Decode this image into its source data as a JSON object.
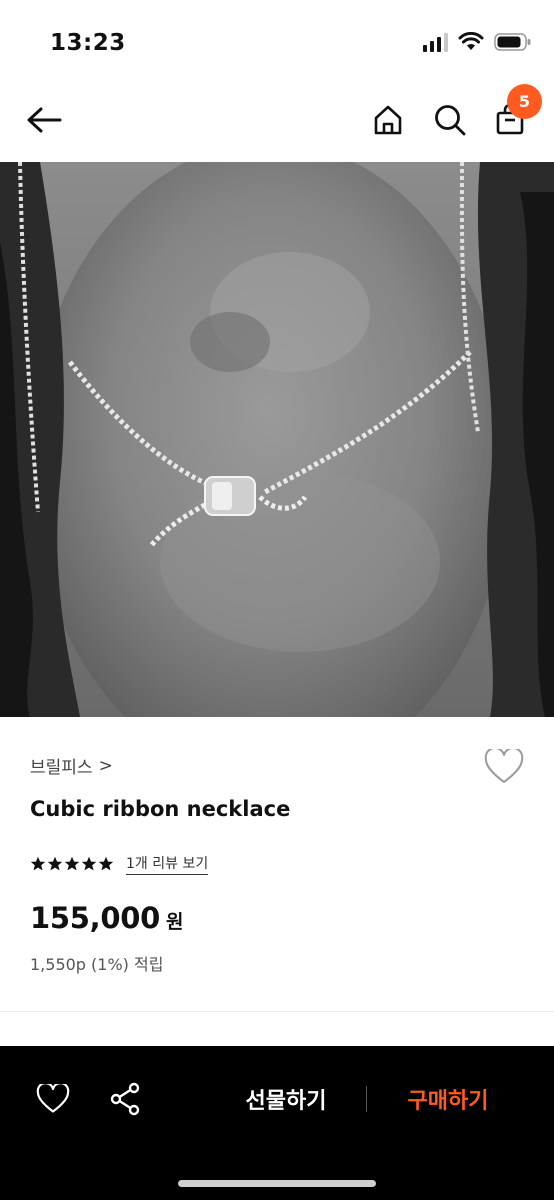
{
  "status_bar": {
    "time": "13:23"
  },
  "nav": {
    "cart_count": "5",
    "icons": [
      "back-arrow-icon",
      "home-icon",
      "search-icon",
      "shopping-bag-icon"
    ]
  },
  "product": {
    "brand": "브릴피스",
    "brand_chevron": ">",
    "name": "Cubic ribbon necklace",
    "rating_stars": 5,
    "review_link": "1개 리뷰 보기",
    "price": "155,000",
    "currency": "원",
    "points": "1,550p (1%) 적립"
  },
  "action_bar": {
    "gift_label": "선물하기",
    "buy_label": "구매하기"
  },
  "colors": {
    "accent": "#ff5a1f",
    "action_bar_bg": "#000000",
    "text": "#111111"
  }
}
